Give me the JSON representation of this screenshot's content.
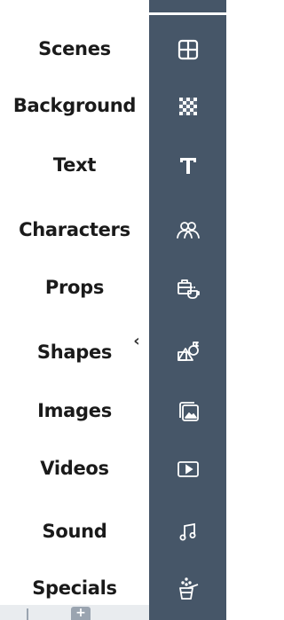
{
  "menu": {
    "items": [
      {
        "label": "Scenes",
        "icon": "scenes-icon"
      },
      {
        "label": "Background",
        "icon": "background-icon"
      },
      {
        "label": "Text",
        "icon": "text-icon"
      },
      {
        "label": "Characters",
        "icon": "characters-icon"
      },
      {
        "label": "Props",
        "icon": "props-icon"
      },
      {
        "label": "Shapes",
        "icon": "shapes-icon"
      },
      {
        "label": "Images",
        "icon": "images-icon"
      },
      {
        "label": "Videos",
        "icon": "videos-icon"
      },
      {
        "label": "Sound",
        "icon": "sound-icon"
      },
      {
        "label": "Specials",
        "icon": "specials-icon"
      }
    ],
    "collapse_glyph": "‹",
    "bottom_plus": "+"
  },
  "colors": {
    "rail": "#465668",
    "icon": "#ffffff",
    "label_text": "#1a1a1a"
  }
}
